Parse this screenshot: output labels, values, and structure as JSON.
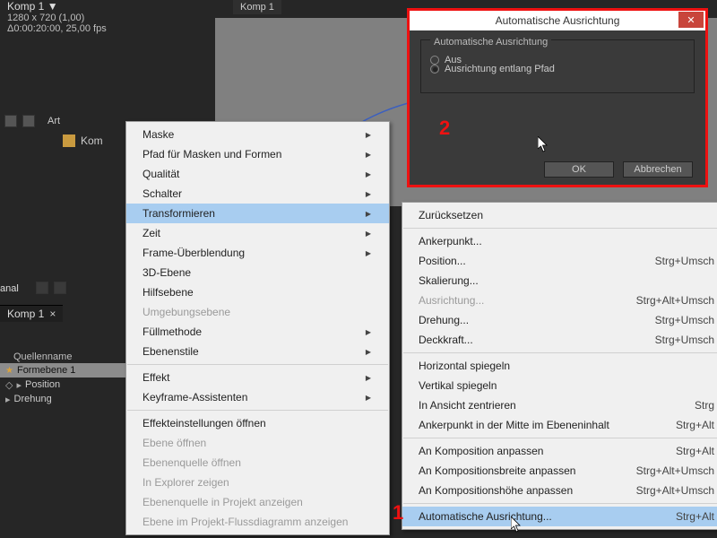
{
  "comp": {
    "title": "Komp 1",
    "dims": "1280 x 720 (1,00)",
    "dur": "Δ0:00:20:00, 25,00 fps",
    "tab_top": "Komp 1"
  },
  "left": {
    "art": "Art",
    "layer_trunc": "Kom",
    "anal": "anal",
    "panel_tab": "Komp 1",
    "tl_header": "Quellenname",
    "tl_row_shape": "Formebene 1",
    "tl_row_position": "Position",
    "tl_row_rotation": "Drehung"
  },
  "context_menu": {
    "maske": "Maske",
    "pfad": "Pfad für Masken und Formen",
    "qualitaet": "Qualität",
    "schalter": "Schalter",
    "transformieren": "Transformieren",
    "zeit": "Zeit",
    "frame": "Frame-Überblendung",
    "dreid": "3D-Ebene",
    "hilfsebene": "Hilfsebene",
    "umgebung": "Umgebungsebene",
    "fuell": "Füllmethode",
    "stile": "Ebenenstile",
    "effekt": "Effekt",
    "keyframe": "Keyframe-Assistenten",
    "effekteinst": "Effekteinstellungen öffnen",
    "ebene_oeffnen": "Ebene öffnen",
    "ebenenquelle": "Ebenenquelle öffnen",
    "explorer": "In Explorer zeigen",
    "projekt": "Ebenenquelle in Projekt anzeigen",
    "fluss": "Ebene im Projekt-Flussdiagramm anzeigen"
  },
  "submenu": {
    "zuruecksetzen": "Zurücksetzen",
    "ankerpunkt": "Ankerpunkt...",
    "position": "Position...",
    "position_sc": "Strg+Umsch",
    "skalierung": "Skalierung...",
    "ausrichtung": "Ausrichtung...",
    "ausrichtung_sc": "Strg+Alt+Umsch",
    "drehung": "Drehung...",
    "drehung_sc": "Strg+Umsch",
    "deckkraft": "Deckkraft...",
    "deckkraft_sc": "Strg+Umsch",
    "hspiegel": "Horizontal spiegeln",
    "vspiegel": "Vertikal spiegeln",
    "ansicht": "In Ansicht zentrieren",
    "ansicht_sc": "Strg",
    "ankermitte": "Ankerpunkt in der Mitte im Ebeneninhalt",
    "ankermitte_sc": "Strg+Alt",
    "komp_anp": "An Komposition anpassen",
    "komp_anp_sc": "Strg+Alt",
    "kompb": "An Kompositionsbreite anpassen",
    "kompb_sc": "Strg+Alt+Umsch",
    "komph": "An Kompositionshöhe anpassen",
    "komph_sc": "Strg+Alt+Umsch",
    "auto": "Automatische Ausrichtung...",
    "auto_sc": "Strg+Alt"
  },
  "dialog": {
    "title": "Automatische Ausrichtung",
    "group": "Automatische Ausrichtung",
    "aus": "Aus",
    "pfad": "Ausrichtung entlang Pfad",
    "ok": "OK",
    "cancel": "Abbrechen"
  },
  "markers": {
    "m1": "1",
    "m2": "2"
  }
}
